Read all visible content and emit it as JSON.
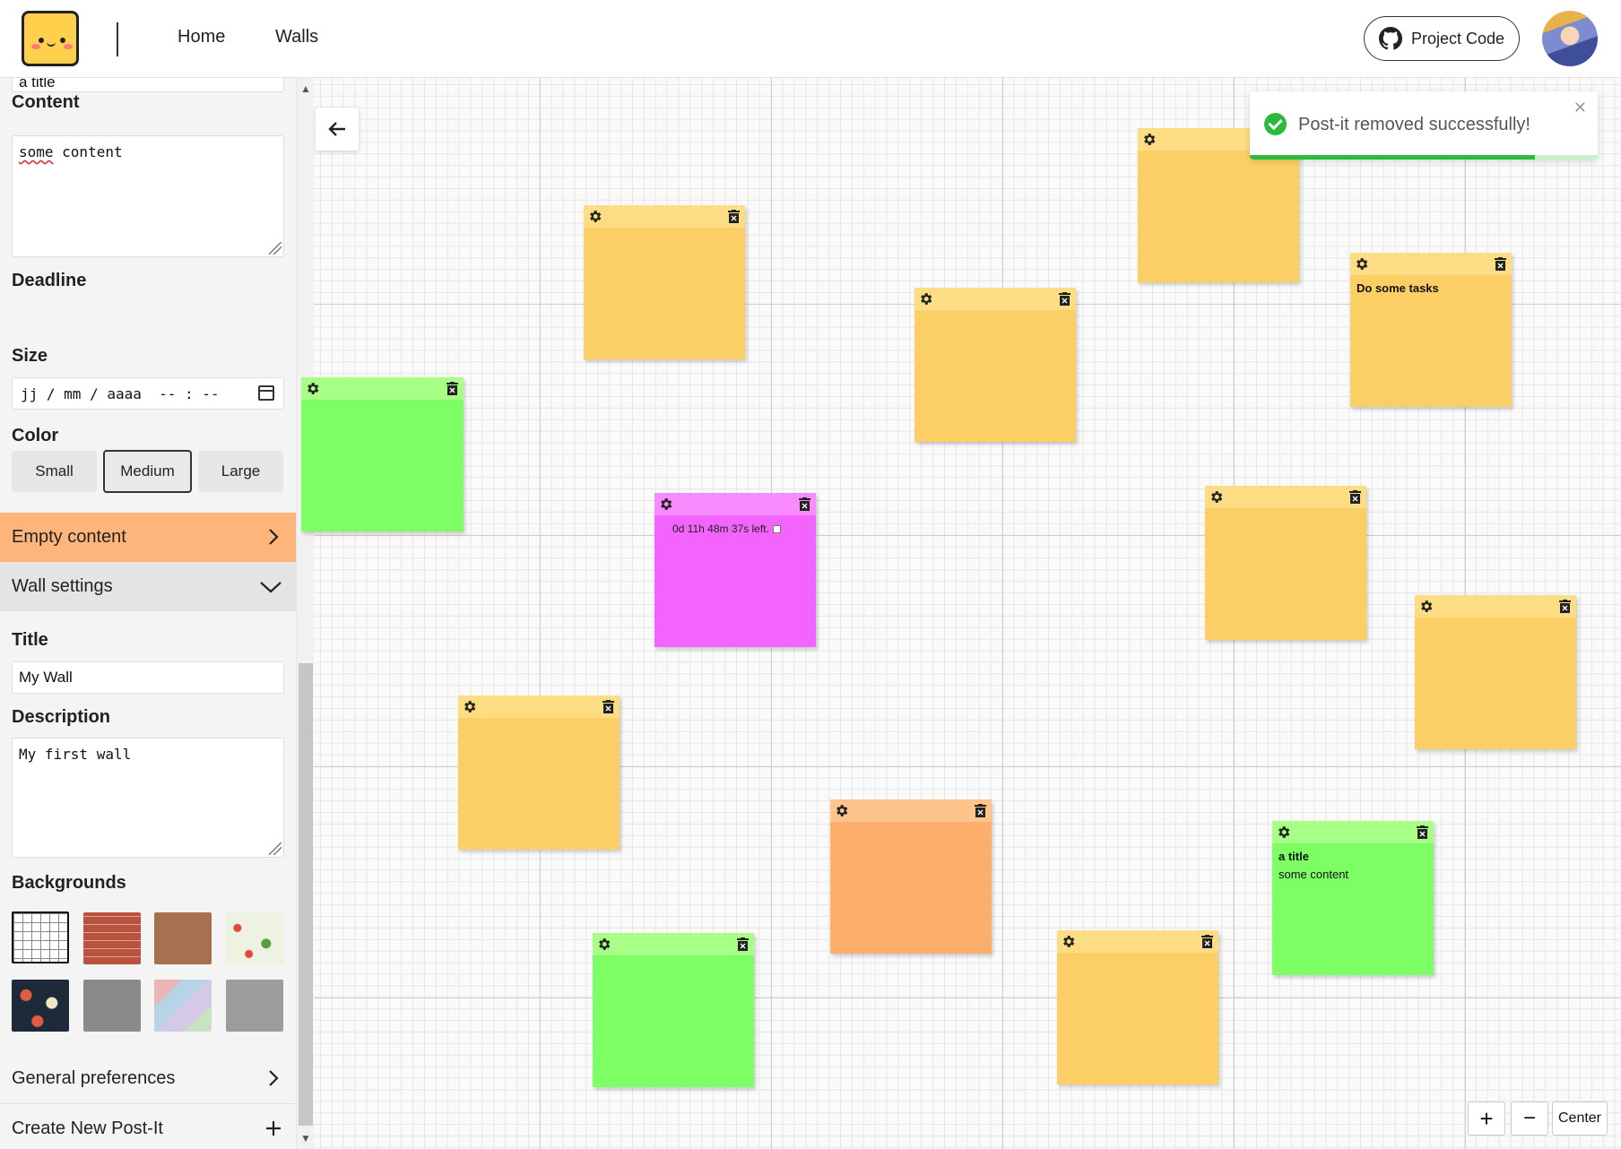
{
  "header": {
    "nav": {
      "home": "Home",
      "walls": "Walls"
    },
    "project_code_label": "Project Code",
    "icons": {
      "logo": "kawaii-postit-logo",
      "github": "github-icon",
      "avatar": "user-avatar"
    }
  },
  "sidebar": {
    "postit_form": {
      "title_value": "a title",
      "content_label": "Content",
      "content_value_first": "some",
      "content_value_rest": " content",
      "deadline_label": "Deadline",
      "deadline_placeholder": "jj / mm / aaaa  -- : --",
      "size_label": "Size",
      "sizes": [
        "Small",
        "Medium",
        "Large"
      ],
      "selected_size": "Medium",
      "color_label": "Color",
      "colors": [
        "#fccf66",
        "#7efe65",
        "#66ccff",
        "#fbaf6a",
        "#f264fb"
      ],
      "selected_color": "#7efe65"
    },
    "empty_content_label": "Empty content",
    "wall_settings": {
      "header": "Wall settings",
      "title_label": "Title",
      "title_value": "My Wall",
      "description_label": "Description",
      "description_value": "My first wall",
      "backgrounds_label": "Backgrounds",
      "backgrounds": [
        "grid",
        "red-brick",
        "brown-texture",
        "floral-light",
        "floral-dark",
        "grey-stone",
        "pastel-scales",
        "grey-concrete"
      ],
      "selected_background": "grid"
    },
    "general_preferences_label": "General preferences",
    "create_postit_label": "Create New Post-It"
  },
  "toast": {
    "message": "Post-it removed successfully!",
    "close_glyph": "✕",
    "progress": 0.82
  },
  "postits": [
    {
      "color": "yellow",
      "title": "",
      "content": ""
    },
    {
      "color": "yellow",
      "title": "",
      "content": ""
    },
    {
      "color": "yellow",
      "title": "",
      "content": ""
    },
    {
      "color": "yellow",
      "title": "Do some tasks",
      "content": ""
    },
    {
      "color": "green",
      "title": "",
      "content": ""
    },
    {
      "color": "pink",
      "timer": "0d 11h 48m 37s left."
    },
    {
      "color": "yellow",
      "title": "",
      "content": ""
    },
    {
      "color": "yellow",
      "title": "",
      "content": ""
    },
    {
      "color": "yellow",
      "title": "",
      "content": ""
    },
    {
      "color": "orange",
      "title": "",
      "content": ""
    },
    {
      "color": "green",
      "title": "a title",
      "content": "some content"
    },
    {
      "color": "green",
      "title": "",
      "content": ""
    },
    {
      "color": "yellow",
      "title": "",
      "content": ""
    }
  ],
  "zoom": {
    "zoom_in": "+",
    "zoom_out": "−",
    "center": "Center"
  }
}
